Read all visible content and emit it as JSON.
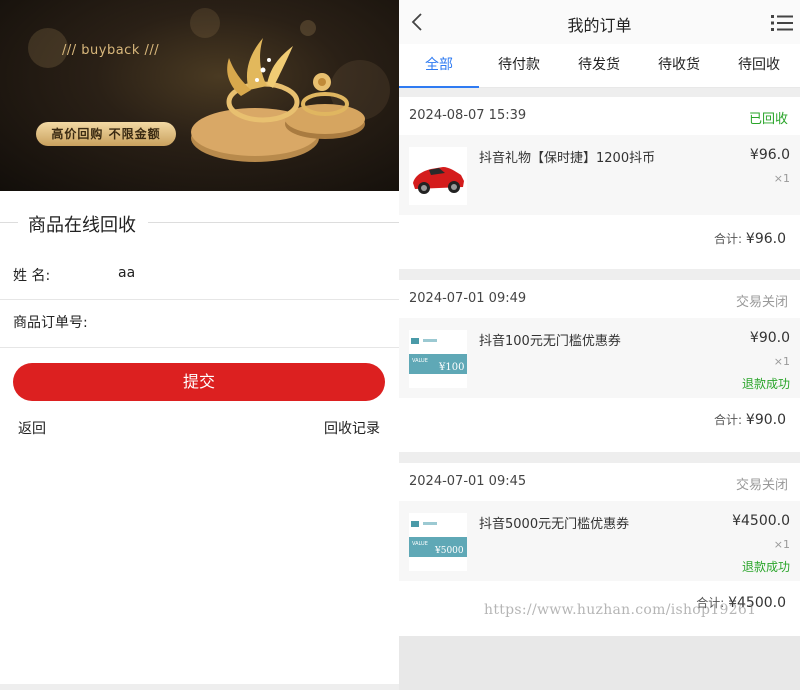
{
  "left": {
    "banner": {
      "brand": "/// buyback ///",
      "tag": "高价回购  不限金额"
    },
    "section_title": "商品在线回收",
    "form": {
      "name_label": "姓 名:",
      "name_value": "aa",
      "order_label": "商品订单号:",
      "order_value": ""
    },
    "submit_label": "提交",
    "back_label": "返回",
    "records_label": "回收记录"
  },
  "right": {
    "title": "我的订单",
    "tabs": [
      "全部",
      "待付款",
      "待发货",
      "待收货",
      "待回收"
    ],
    "active_tab": "全部",
    "orders": [
      {
        "date": "2024-08-07 15:39",
        "status": "已回收",
        "status_color": "#2aa52a",
        "item": {
          "name": "抖音礼物【保时捷】1200抖币",
          "price": "¥96.0",
          "qty": "×1",
          "refund": "",
          "thumb": "red-sports-car"
        },
        "total_label": "合计:",
        "total": "¥96.0"
      },
      {
        "date": "2024-07-01 09:49",
        "status": "交易关闭",
        "status_color": "#999999",
        "item": {
          "name": "抖音100元无门槛优惠券",
          "price": "¥90.0",
          "qty": "×1",
          "refund": "退款成功",
          "thumb": "coupon-100",
          "coupon_value": "¥100"
        },
        "total_label": "合计:",
        "total": "¥90.0"
      },
      {
        "date": "2024-07-01 09:45",
        "status": "交易关闭",
        "status_color": "#999999",
        "item": {
          "name": "抖音5000元无门槛优惠券",
          "price": "¥4500.0",
          "qty": "×1",
          "refund": "退款成功",
          "thumb": "coupon-5000",
          "coupon_value": "¥5000"
        },
        "total_label": "合计:",
        "total": "¥4500.0"
      }
    ]
  },
  "watermark": "https://www.huzhan.com/ishop19261",
  "colors": {
    "accent_blue": "#2f7bf2",
    "submit_red": "#dc2020",
    "status_green": "#2aa52a"
  }
}
